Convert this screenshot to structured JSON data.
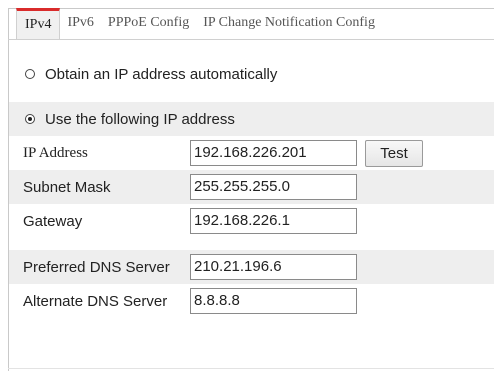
{
  "tabs": [
    {
      "label": "IPv4"
    },
    {
      "label": "IPv6"
    },
    {
      "label": "PPPoE Config"
    },
    {
      "label": "IP Change Notification Config"
    }
  ],
  "options": {
    "auto_label": "Obtain an IP address automatically",
    "manual_label": "Use the following IP address"
  },
  "fields": {
    "ip_address": {
      "label": "IP Address",
      "value": "192.168.226.201"
    },
    "subnet_mask": {
      "label": "Subnet Mask",
      "value": "255.255.255.0"
    },
    "gateway": {
      "label": "Gateway",
      "value": "192.168.226.1"
    },
    "preferred_dns": {
      "label": "Preferred DNS Server",
      "value": "210.21.196.6"
    },
    "alternate_dns": {
      "label": "Alternate DNS Server",
      "value": "8.8.8.8"
    }
  },
  "buttons": {
    "test_label": "Test"
  }
}
